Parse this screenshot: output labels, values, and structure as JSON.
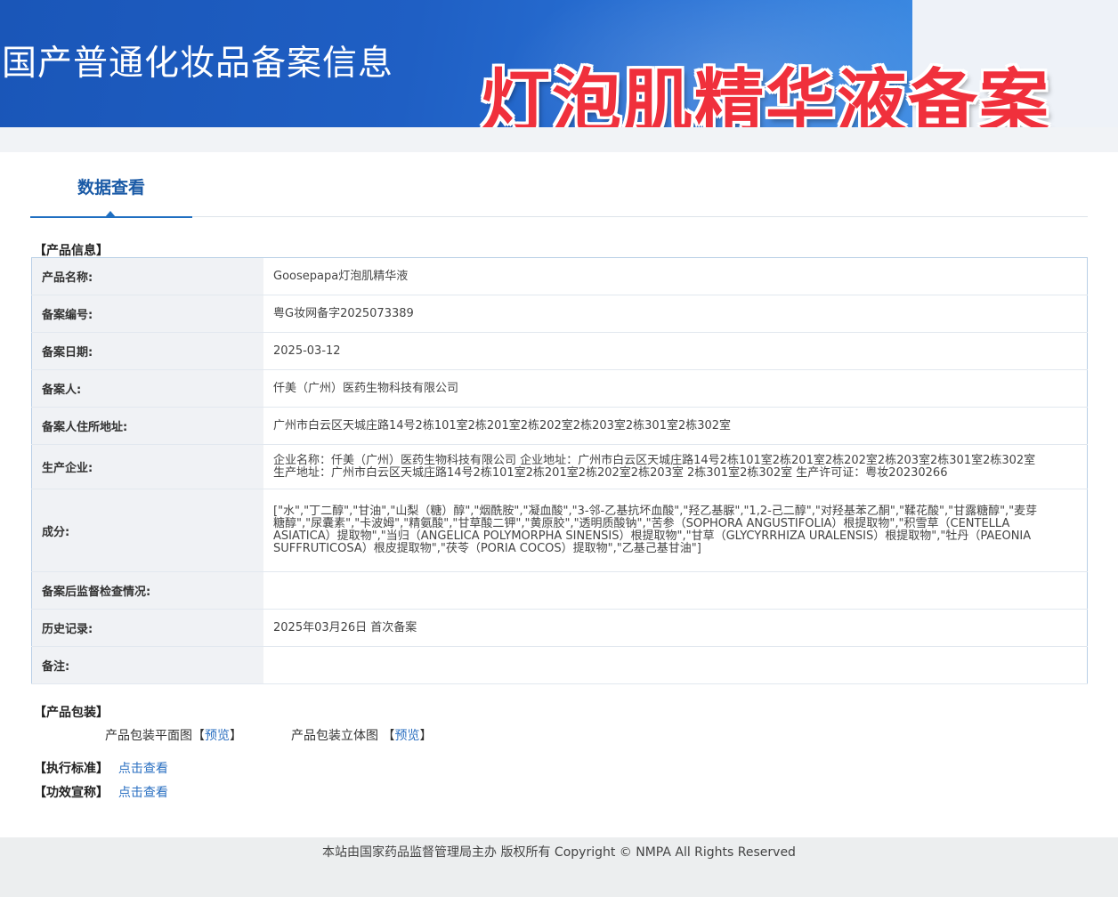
{
  "banner": {
    "site_title": "国产普通化妆品备案信息",
    "overlay_title": "灯泡肌精华液备案"
  },
  "tabs": [
    {
      "label": "数据查看",
      "active": true
    }
  ],
  "product_info": {
    "section_label": "【产品信息】",
    "rows": [
      {
        "key": "产品名称:",
        "value": "Goosepapa灯泡肌精华液"
      },
      {
        "key": "备案编号:",
        "value": "粤G妆网备字2025073389"
      },
      {
        "key": "备案日期:",
        "value": "2025-03-12"
      },
      {
        "key": "备案人:",
        "value": "仟美（广州）医药生物科技有限公司"
      },
      {
        "key": "备案人住所地址:",
        "value": "广州市白云区天城庄路14号2栋101室2栋201室2栋202室2栋203室2栋301室2栋302室"
      },
      {
        "key": "生产企业:",
        "value": "企业名称：仟美（广州）医药生物科技有限公司 企业地址：广州市白云区天城庄路14号2栋101室2栋201室2栋202室2栋203室2栋301室2栋302室 生产地址：广州市白云区天城庄路14号2栋101室2栋201室2栋202室2栋203室 2栋301室2栋302室 生产许可证：粤妆20230266"
      },
      {
        "key": "成分:",
        "value": "[\"水\",\"丁二醇\",\"甘油\",\"山梨（糖）醇\",\"烟酰胺\",\"凝血酸\",\"3-邻-乙基抗坏血酸\",\"羟乙基脲\",\"1,2-己二醇\",\"对羟基苯乙酮\",\"鞣花酸\",\"甘露糖醇\",\"麦芽糖醇\",\"尿囊素\",\"卡波姆\",\"精氨酸\",\"甘草酸二钾\",\"黄原胶\",\"透明质酸钠\",\"苦参（SOPHORA ANGUSTIFOLIA）根提取物\",\"积雪草（CENTELLA ASIATICA）提取物\",\"当归（ANGELICA POLYMORPHA SINENSIS）根提取物\",\"甘草（GLYCYRRHIZA URALENSIS）根提取物\",\"牡丹（PAEONIA SUFFRUTICOSA）根皮提取物\",\"茯苓（PORIA COCOS）提取物\",\"乙基己基甘油\"]"
      },
      {
        "key": "备案后监督检查情况:",
        "value": ""
      },
      {
        "key": "历史记录:",
        "value": "2025年03月26日 首次备案"
      },
      {
        "key": "备注:",
        "value": ""
      }
    ]
  },
  "packaging": {
    "section_label": "【产品包装】",
    "flat_label": "产品包装平面图",
    "flat_link": "预览",
    "stereo_label": "产品包装立体图",
    "stereo_link": "预览"
  },
  "standards": {
    "label": "【执行标准】",
    "link": "点击查看"
  },
  "efficacy": {
    "label": "【功效宣称】",
    "link": "点击查看"
  },
  "footer": {
    "text": "本站由国家药品监督管理局主办 版权所有 Copyright © NMPA All Rights Reserved"
  }
}
